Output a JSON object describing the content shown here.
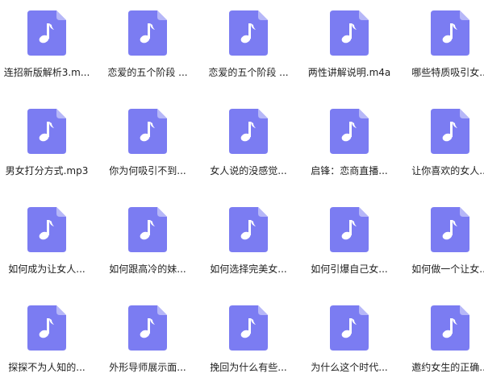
{
  "colors": {
    "icon_body": "#7b7cf2",
    "icon_fold": "#b6b7f8",
    "note": "#ffffff",
    "label": "#1f1f1f",
    "background": "#ffffff"
  },
  "file_icon": "music-file-icon",
  "files": [
    {
      "name": "连招新版解析3.m..."
    },
    {
      "name": "恋爱的五个阶段 ..."
    },
    {
      "name": "恋爱的五个阶段 ..."
    },
    {
      "name": "两性讲解说明.m4a"
    },
    {
      "name": "哪些特质吸引女..."
    },
    {
      "name": "男女打分方式.mp3"
    },
    {
      "name": "你为何吸引不到..."
    },
    {
      "name": "女人说的没感觉..."
    },
    {
      "name": "启锋：恋商直播..."
    },
    {
      "name": "让你喜欢的女人..."
    },
    {
      "name": "如何成为让女人..."
    },
    {
      "name": "如何跟高冷的妹..."
    },
    {
      "name": "如何选择完美女..."
    },
    {
      "name": "如何引爆自己女..."
    },
    {
      "name": "如何做一个让女..."
    },
    {
      "name": "探探不为人知的..."
    },
    {
      "name": "外形导师展示面..."
    },
    {
      "name": "挽回为什么有些..."
    },
    {
      "name": "为什么这个时代..."
    },
    {
      "name": "邀约女生的正确..."
    }
  ]
}
